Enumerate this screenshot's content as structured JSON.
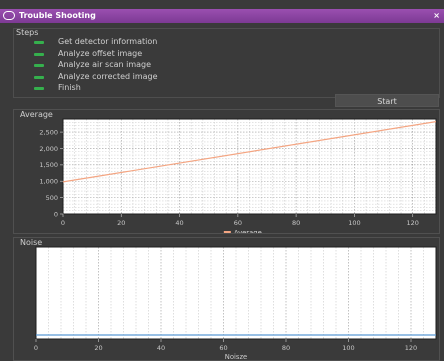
{
  "window": {
    "title": "Trouble Shooting",
    "close_glyph": "×"
  },
  "steps": {
    "title": "Steps",
    "items": [
      {
        "label": "Get detector information",
        "done": true
      },
      {
        "label": "Analyze offset image",
        "done": true
      },
      {
        "label": "Analyze air scan image",
        "done": true
      },
      {
        "label": "Analyze corrected image",
        "done": true
      },
      {
        "label": "Finish",
        "done": true
      }
    ]
  },
  "start_button": {
    "label": "Start"
  },
  "chart_data": [
    {
      "type": "line",
      "panel_title": "Average",
      "xlabel": "",
      "legend": "Average",
      "series": [
        {
          "name": "Average",
          "color": "#f4a582",
          "x": [
            0,
            128
          ],
          "y": [
            980,
            2820
          ]
        }
      ],
      "xlim": [
        0,
        128
      ],
      "ylim": [
        0,
        2900
      ],
      "xticks": [
        0,
        20,
        40,
        60,
        80,
        100,
        120
      ],
      "yticks": [
        0,
        500,
        1000,
        1500,
        2000,
        2500
      ],
      "ytick_labels": [
        "0",
        "500",
        "1,000",
        "1,500",
        "2,000",
        "2,500"
      ],
      "grid": true
    },
    {
      "type": "line",
      "panel_title": "Noise",
      "xlabel": "Noisze",
      "series": [
        {
          "name": "Noise",
          "color": "#5b9bd5",
          "x": [
            0,
            128
          ],
          "y": [
            0,
            0
          ]
        }
      ],
      "xlim": [
        0,
        128
      ],
      "xticks": [
        0,
        20,
        40,
        60,
        80,
        100,
        120
      ],
      "grid": true
    }
  ]
}
